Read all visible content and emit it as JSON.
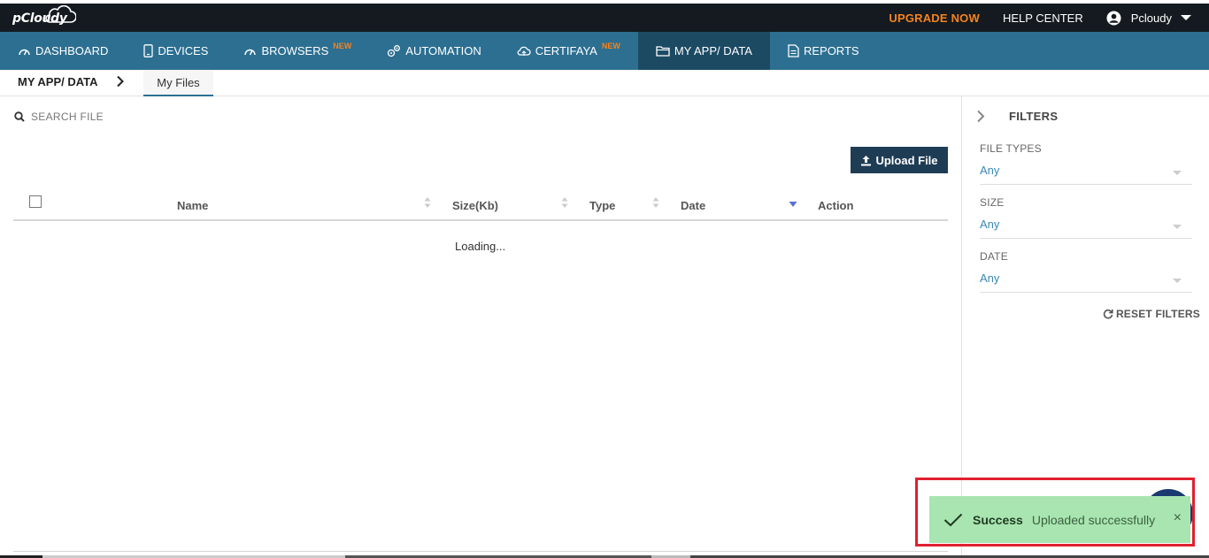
{
  "brand": {
    "logo_text": "pCloudy"
  },
  "topbar": {
    "upgrade_label": "UPGRADE NOW",
    "help_label": "HELP CENTER",
    "user_name": "Pcloudy",
    "accent_color": "#f58220"
  },
  "nav": {
    "items": [
      {
        "label": "DASHBOARD",
        "icon": "gauge-icon",
        "badge": ""
      },
      {
        "label": "DEVICES",
        "icon": "phone-icon",
        "badge": ""
      },
      {
        "label": "BROWSERS",
        "icon": "gauge-icon",
        "badge": "NEW"
      },
      {
        "label": "AUTOMATION",
        "icon": "gears-icon",
        "badge": ""
      },
      {
        "label": "CERTIFAYA",
        "icon": "cloud-icon",
        "badge": "NEW"
      },
      {
        "label": "MY APP/ DATA",
        "icon": "folder-icon",
        "badge": "",
        "active": true
      },
      {
        "label": "REPORTS",
        "icon": "document-icon",
        "badge": ""
      }
    ]
  },
  "breadcrumb": {
    "root": "MY APP/ DATA",
    "current_tab": "My Files"
  },
  "search": {
    "placeholder": "SEARCH FILE",
    "value": ""
  },
  "toolbar": {
    "upload_label": "Upload File"
  },
  "table": {
    "columns": [
      "Name",
      "Size(Kb)",
      "Type",
      "Date",
      "Action"
    ],
    "sorted_column": "Date",
    "sort_direction": "descending",
    "loading_text": "Loading..."
  },
  "filters": {
    "title": "FILTERS",
    "groups": [
      {
        "label": "FILE TYPES",
        "value": "Any"
      },
      {
        "label": "SIZE",
        "value": "Any"
      },
      {
        "label": "DATE",
        "value": "Any"
      }
    ],
    "reset_label": "RESET FILTERS"
  },
  "toast": {
    "title": "Success",
    "message": "Uploaded successfully",
    "close_glyph": "×",
    "color": "#a9e5b0"
  },
  "colors": {
    "navbar": "#2c6f91",
    "navbar_active": "#1c4a63",
    "topbar": "#141a1f",
    "highlight_border": "#e02030"
  }
}
